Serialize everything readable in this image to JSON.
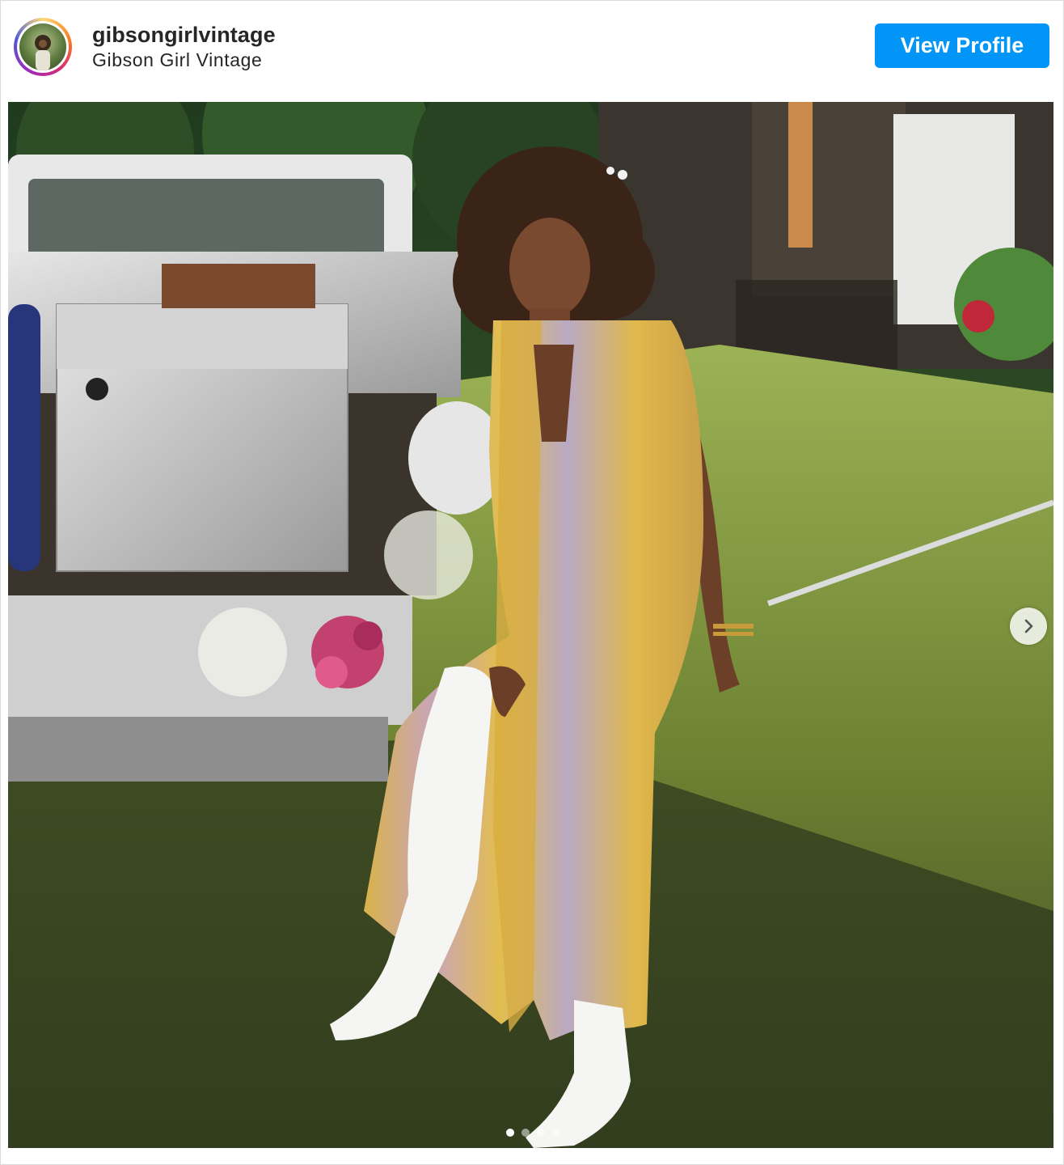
{
  "header": {
    "username": "gibsongirlvintage",
    "full_name": "Gibson Girl Vintage",
    "view_profile_label": "View Profile",
    "avatar_icon": "profile-avatar"
  },
  "post": {
    "image_icon": "post-photo",
    "next_icon": "chevron-right-icon",
    "carousel": {
      "total": 4,
      "active_index": 0
    }
  },
  "colors": {
    "button": "#0095f6",
    "border": "#dbdbdb",
    "text": "#262626"
  }
}
